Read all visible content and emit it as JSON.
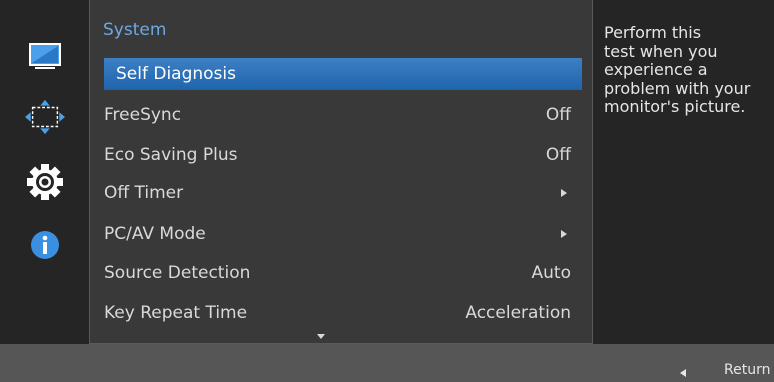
{
  "sidebar": {
    "icons": [
      "monitor-icon",
      "resize-arrows-icon",
      "gear-icon",
      "info-icon"
    ]
  },
  "menu": {
    "title": "System",
    "items": [
      {
        "label": "Self Diagnosis",
        "value": "",
        "arrow": false,
        "selected": true
      },
      {
        "label": "FreeSync",
        "value": "Off",
        "arrow": false,
        "selected": false
      },
      {
        "label": "Eco Saving Plus",
        "value": "Off",
        "arrow": false,
        "selected": false
      },
      {
        "label": "Off Timer",
        "value": "",
        "arrow": true,
        "selected": false
      },
      {
        "label": "PC/AV Mode",
        "value": "",
        "arrow": true,
        "selected": false
      },
      {
        "label": "Source Detection",
        "value": "Auto",
        "arrow": false,
        "selected": false
      },
      {
        "label": "Key Repeat Time",
        "value": "Acceleration",
        "arrow": false,
        "selected": false
      }
    ]
  },
  "help": {
    "lines": [
      "Perform this",
      "test when you",
      "experience a",
      "problem with your",
      "monitor's picture."
    ]
  },
  "footer": {
    "return_label": "Return"
  },
  "colors": {
    "accent": "#6ea8e3",
    "selection": "#2a72bb",
    "panel": "#393939",
    "footer": "#565656"
  }
}
